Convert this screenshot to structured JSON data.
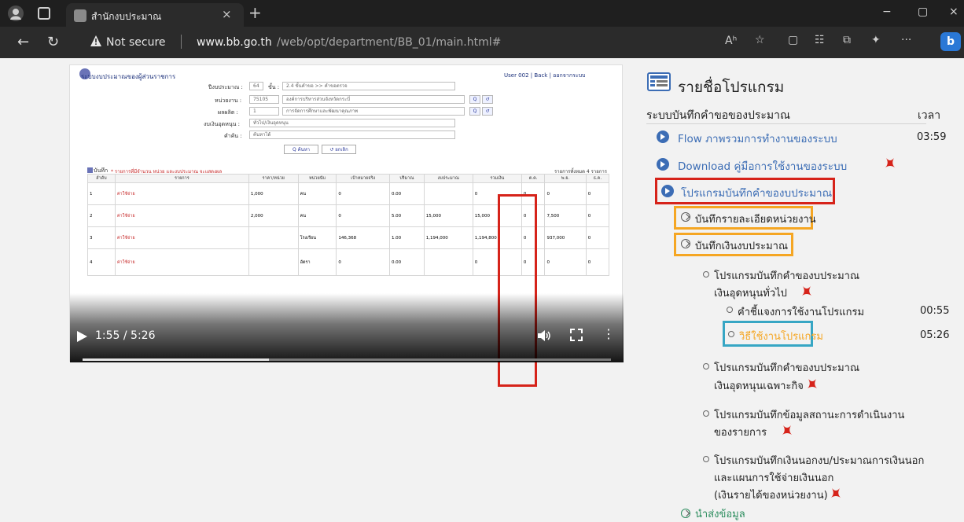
{
  "browser": {
    "tab": {
      "title": "สำนักงบประมาณ",
      "close": "×",
      "new_tab": "+"
    },
    "window": {
      "minimize": "−",
      "maximize": "▢",
      "close": "×"
    },
    "address": {
      "not_secure": "Not secure",
      "url_host": "www.bb.go.th",
      "url_path": "/web/opt/department/BB_01/main.html#"
    },
    "toolbar": {
      "read_aloud": "Aʰ",
      "favorite": "☆",
      "split": "▢",
      "favorites_bar": "☷",
      "collections": "⧉",
      "extensions": "✦",
      "more": "···",
      "bing": "b"
    }
  },
  "video": {
    "time": "1:55 / 5:26",
    "progress_fraction": 0.353,
    "app": {
      "header_title": "ระบบงบประมาณของผู้ส่วนราชการ",
      "header_user": "User 002 | Back | ออกจากระบบ",
      "form_rows": [
        {
          "label": "ปีงบประมาณ :",
          "value": "64",
          "label2": "ขั้น :",
          "value2": "2.4 ขั้นคำขอ >> คำขอตรวจ"
        },
        {
          "label": "หน่วยงาน :",
          "value": "75105",
          "value2": "องค์การบริหารส่วนจังหวัดกระบี่"
        },
        {
          "label": "ผลผลิต :",
          "value": "1",
          "value2": "การจัดการศึกษาและพัฒนาคุณภาพ"
        },
        {
          "label": "งบเงินอุดหนุน :",
          "value2": "ทั่วไป/เงินอุดหนุน"
        },
        {
          "label": "คำค้น :",
          "value2": "ค้นหาได้"
        }
      ],
      "search_btn": "Q ค้นหา",
      "clear_btn": "↺ ยกเลิก",
      "save_label": "บันทึก",
      "note": "* รายการที่มีจำนวน หน่วย และงบประมาณ จะแสดงผล",
      "count": "รายการทั้งหมด 4 รายการ",
      "table": {
        "headers": [
          "ลำดับ",
          "รายการ",
          "ราคา/หน่วย",
          "หน่วยนับ",
          "เป้าหมายจริง",
          "ปริมาณ",
          "งบประมาณ",
          "รวมเงิน",
          "ต.ค.",
          "พ.ย.",
          "ธ.ค."
        ],
        "rows": [
          [
            "1",
            "ค่าใช้จ่าย",
            "1,000",
            "คน",
            "0",
            "0.00",
            "",
            "0",
            "0",
            "0",
            "0"
          ],
          [
            "2",
            "ค่าใช้จ่าย",
            "2,000",
            "คน",
            "0",
            "5.00",
            "15,000",
            "15,000",
            "0",
            "7,500",
            "0"
          ],
          [
            "3",
            "ค่าใช้จ่าย",
            "",
            "โรงเรียน",
            "146,368",
            "1.00",
            "1,194,000",
            "1,194,800",
            "0",
            "937,000",
            "0"
          ],
          [
            "4",
            "ค่าใช้จ่าย",
            "",
            "อัตรา",
            "0",
            "0.00",
            "",
            "0",
            "0",
            "0",
            "0"
          ]
        ]
      }
    }
  },
  "panel": {
    "title": "รายชื่อโปรแกรม",
    "section": "ระบบบันทึกคำขอของประมาณ",
    "time_header": "เวลา",
    "items": [
      {
        "label": "Flow ภาพรวมการทำงานของระบบ",
        "time": "03:59"
      },
      {
        "label": "Download คู่มือการใช้งานของระบบ"
      },
      {
        "label": "โปรแกรมบันทึกคำของบประมาณ"
      }
    ],
    "sub_items": [
      {
        "label": "บันทึกรายละเอียดหน่วยงาน"
      },
      {
        "label": "บันทึกเงินงบประมาณ"
      }
    ],
    "program1": {
      "line1": "โปรแกรมบันทึกคำของบประมาณ",
      "line2": "เงินอุดหนุนทั่วไป"
    },
    "explain": {
      "label": "คำชี้แจงการใช้งานโปรแกรม",
      "time": "00:55"
    },
    "howto": {
      "label": "วิธีใช้งานโปรแกรม",
      "time": "05:26"
    },
    "program2": {
      "line1": "โปรแกรมบันทึกคำของบประมาณ",
      "line2": "เงินอุดหนุนเฉพาะกิจ"
    },
    "program3": {
      "line1": "โปรแกรมบันทึกข้อมูลสถานะการดำเนินงาน",
      "line2": "ของรายการ"
    },
    "program4": {
      "line1": "โปรแกรมบันทึกเงินนอกงบ/ประมาณการเงินนอก",
      "line2": "และแผนการใช้จ่ายเงินนอก",
      "line3": "(เงินรายได้ของหน่วยงาน)"
    },
    "bottom": {
      "label": "นำส่งข้อมูล"
    }
  },
  "colors": {
    "highlight_red": "#d6231a",
    "highlight_orange": "#f5a623",
    "highlight_cyan": "#37a6c4",
    "link_blue": "#3c6db5"
  }
}
